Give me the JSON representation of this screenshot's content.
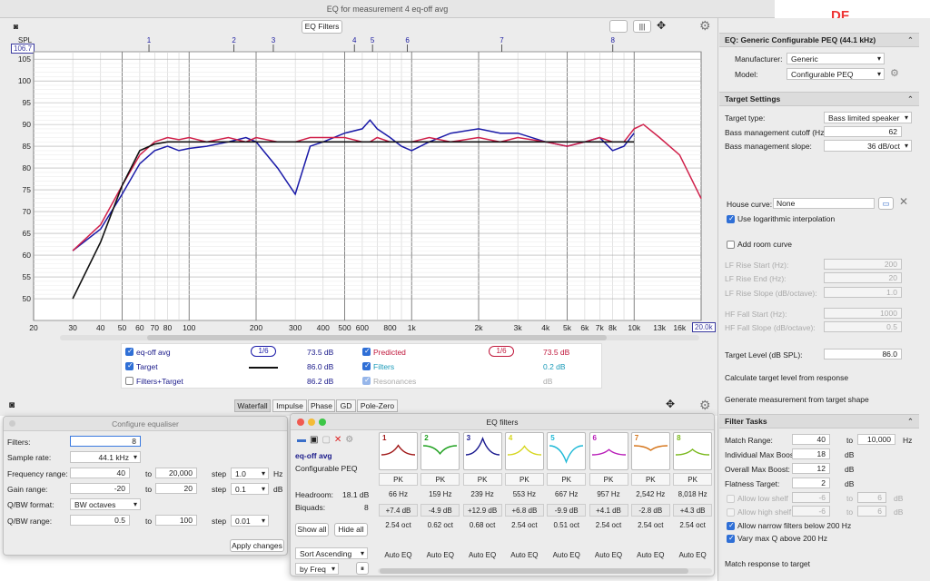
{
  "window": {
    "title": "EQ for measurement 4 eq-off avg",
    "logo": "DF"
  },
  "toolbar": {
    "eq_filters_label": "EQ Filters"
  },
  "graph": {
    "spl_label": "SPL",
    "spl_top_value": "106.7",
    "xmax_box": "20.0k",
    "y_ticks": [
      "105",
      "100",
      "95",
      "90",
      "85",
      "80",
      "75",
      "70",
      "65",
      "60",
      "55",
      "50"
    ],
    "x_ticks": [
      "20",
      "30",
      "40",
      "50",
      "60",
      "70",
      "80",
      "100",
      "200",
      "300",
      "400",
      "500",
      "600",
      "800",
      "1k",
      "2k",
      "3k",
      "4k",
      "5k",
      "6k",
      "7k",
      "8k",
      "10k",
      "13k",
      "16k"
    ],
    "filter_markers": [
      "1",
      "2",
      "3",
      "4",
      "5",
      "6",
      "7",
      "8"
    ]
  },
  "chart_data": {
    "type": "line",
    "xlabel": "",
    "ylabel": "SPL",
    "xscale": "log",
    "xlim": [
      20,
      20000
    ],
    "ylim": [
      45,
      106.7
    ],
    "series": [
      {
        "name": "eq-off avg",
        "color": "#1a1aa8",
        "x": [
          30,
          40,
          50,
          60,
          70,
          80,
          90,
          100,
          120,
          150,
          180,
          200,
          250,
          300,
          350,
          400,
          500,
          600,
          650,
          700,
          800,
          900,
          1000,
          1200,
          1500,
          2000,
          2500,
          3000,
          4000,
          5000,
          6000,
          7000,
          8000,
          9000,
          10000
        ],
        "y": [
          61,
          66,
          74,
          81,
          84,
          85,
          84,
          84.5,
          85,
          86,
          87,
          86,
          80,
          74,
          85,
          86,
          88,
          89,
          91,
          89,
          87,
          85,
          84,
          86,
          88,
          89,
          88,
          88,
          86,
          85,
          86,
          87,
          84,
          85,
          88
        ]
      },
      {
        "name": "Predicted",
        "color": "#d0204a",
        "x": [
          30,
          40,
          50,
          60,
          70,
          80,
          90,
          100,
          120,
          150,
          180,
          200,
          250,
          300,
          350,
          400,
          500,
          600,
          650,
          700,
          800,
          900,
          1000,
          1200,
          1500,
          2000,
          2500,
          3000,
          4000,
          5000,
          6000,
          7000,
          8000,
          9000,
          10000,
          11000,
          13000,
          16000,
          20000
        ],
        "y": [
          61,
          67,
          76,
          83,
          86,
          87,
          86.5,
          87,
          86,
          87,
          86,
          87,
          86,
          86,
          87,
          87,
          87,
          86,
          86,
          87,
          86,
          86,
          86,
          87,
          86,
          87,
          86,
          87,
          86,
          85,
          86,
          87,
          86,
          86,
          89,
          90,
          87,
          83,
          73
        ]
      },
      {
        "name": "Target",
        "color": "#111111",
        "x": [
          30,
          40,
          50,
          60,
          70,
          80,
          100,
          1000,
          10000
        ],
        "y": [
          50,
          63,
          76,
          84,
          85.5,
          86,
          86,
          86,
          86
        ]
      }
    ]
  },
  "legend": {
    "rows": [
      {
        "name": "eq-off avg",
        "value": "73.5 dB",
        "checked": true,
        "smooth": "1/6"
      },
      {
        "name": "Target",
        "value": "86.0 dB",
        "checked": true
      },
      {
        "name": "Filters+Target",
        "value": "86.2 dB",
        "checked": false
      }
    ],
    "rows_right": [
      {
        "name": "Predicted",
        "value": "73.5 dB",
        "checked": true,
        "smooth": "1/6"
      },
      {
        "name": "Filters",
        "value": "0.2 dB",
        "checked": true
      },
      {
        "name": "Resonances",
        "value": "dB",
        "checked": true
      }
    ]
  },
  "bottom_tabs": [
    "Waterfall",
    "Impulse",
    "Phase",
    "GD",
    "Pole-Zero"
  ],
  "right": {
    "eq_header": "EQ: Generic Configurable PEQ (44.1 kHz)",
    "manufacturer_label": "Manufacturer:",
    "manufacturer": "Generic",
    "model_label": "Model:",
    "model": "Configurable PEQ",
    "target_header": "Target Settings",
    "target_type_label": "Target type:",
    "target_type": "Bass limited speaker",
    "bass_cutoff_label": "Bass management cutoff (Hz):",
    "bass_cutoff": "62",
    "bass_slope_label": "Bass management slope:",
    "bass_slope": "36 dB/oct",
    "house_curve_label": "House curve:",
    "house_curve": "None",
    "log_interp": "Use logarithmic interpolation",
    "add_room": "Add room curve",
    "lf_rise_start_label": "LF Rise Start (Hz):",
    "lf_rise_start": "200",
    "lf_rise_end_label": "LF Rise End (Hz):",
    "lf_rise_end": "20",
    "lf_rise_slope_label": "LF Rise Slope (dB/octave):",
    "lf_rise_slope": "1.0",
    "hf_fall_start_label": "HF Fall Start (Hz):",
    "hf_fall_start": "1000",
    "hf_fall_slope_label": "HF Fall Slope (dB/octave):",
    "hf_fall_slope": "0.5",
    "target_level_label": "Target Level (dB SPL):",
    "target_level": "86.0",
    "calc_target": "Calculate target level from response",
    "gen_meas": "Generate measurement from target shape",
    "filter_tasks_header": "Filter Tasks",
    "match_range_label": "Match Range:",
    "match_from": "40",
    "match_to": "10,000",
    "to": "to",
    "hz": "Hz",
    "ind_max_label": "Individual Max Boost:",
    "ind_max": "18",
    "db": "dB",
    "overall_max_label": "Overall Max Boost:",
    "overall_max": "12",
    "flatness_label": "Flatness Target:",
    "flatness": "2",
    "low_shelf": "Allow low shelf",
    "low_shelf_a": "-6",
    "low_shelf_b": "6",
    "high_shelf": "Allow high shelf",
    "high_shelf_a": "-6",
    "high_shelf_b": "6",
    "narrow": "Allow narrow filters below 200 Hz",
    "varyq": "Vary max Q above 200 Hz",
    "match_resp": "Match response to target"
  },
  "configure": {
    "title": "Configure equaliser",
    "filters_label": "Filters:",
    "filters": "8",
    "sample_rate_label": "Sample rate:",
    "sample_rate": "44.1 kHz",
    "freq_range_label": "Frequency range:",
    "freq_from": "40",
    "freq_to": "20,000",
    "freq_step": "1.0",
    "hz": "Hz",
    "gain_range_label": "Gain range:",
    "gain_from": "-20",
    "gain_to": "20",
    "gain_step": "0.1",
    "db": "dB",
    "qbw_format_label": "Q/BW format:",
    "qbw_format": "BW octaves",
    "qbw_range_label": "Q/BW range:",
    "qbw_from": "0.5",
    "qbw_to": "100",
    "qbw_step": "0.01",
    "to": "to",
    "step": "step",
    "apply": "Apply changes"
  },
  "eqf": {
    "title": "EQ filters",
    "meas_name": "eq-off avg",
    "device": "Configurable PEQ",
    "headroom_label": "Headroom:",
    "headroom": "18.1 dB",
    "biquads_label": "Biquads:",
    "biquads": "8",
    "show_all": "Show all",
    "hide_all": "Hide all",
    "sort": "Sort Ascending",
    "by": "by Freq",
    "filters": [
      {
        "n": "1",
        "color": "#a01818",
        "type": "PK",
        "freq": "66 Hz",
        "gain": "+7.4 dB",
        "bw": "2.54 oct",
        "mode": "Auto EQ"
      },
      {
        "n": "2",
        "color": "#1ea01e",
        "type": "PK",
        "freq": "159 Hz",
        "gain": "-4.9 dB",
        "bw": "0.62 oct",
        "mode": "Auto EQ"
      },
      {
        "n": "3",
        "color": "#18188e",
        "type": "PK",
        "freq": "239 Hz",
        "gain": "+12.9 dB",
        "bw": "0.68 oct",
        "mode": "Auto EQ"
      },
      {
        "n": "4",
        "color": "#d6d61c",
        "type": "PK",
        "freq": "553 Hz",
        "gain": "+6.8 dB",
        "bw": "2.54 oct",
        "mode": "Auto EQ"
      },
      {
        "n": "5",
        "color": "#1cb8d6",
        "type": "PK",
        "freq": "667 Hz",
        "gain": "-9.9 dB",
        "bw": "0.51 oct",
        "mode": "Auto EQ"
      },
      {
        "n": "6",
        "color": "#b81cb8",
        "type": "PK",
        "freq": "957 Hz",
        "gain": "+4.1 dB",
        "bw": "2.54 oct",
        "mode": "Auto EQ"
      },
      {
        "n": "7",
        "color": "#d6761c",
        "type": "PK",
        "freq": "2,542 Hz",
        "gain": "-2.8 dB",
        "bw": "2.54 oct",
        "mode": "Auto EQ"
      },
      {
        "n": "8",
        "color": "#7ab81c",
        "type": "PK",
        "freq": "8,018 Hz",
        "gain": "+4.3 dB",
        "bw": "2.54 oct",
        "mode": "Auto EQ"
      }
    ]
  }
}
